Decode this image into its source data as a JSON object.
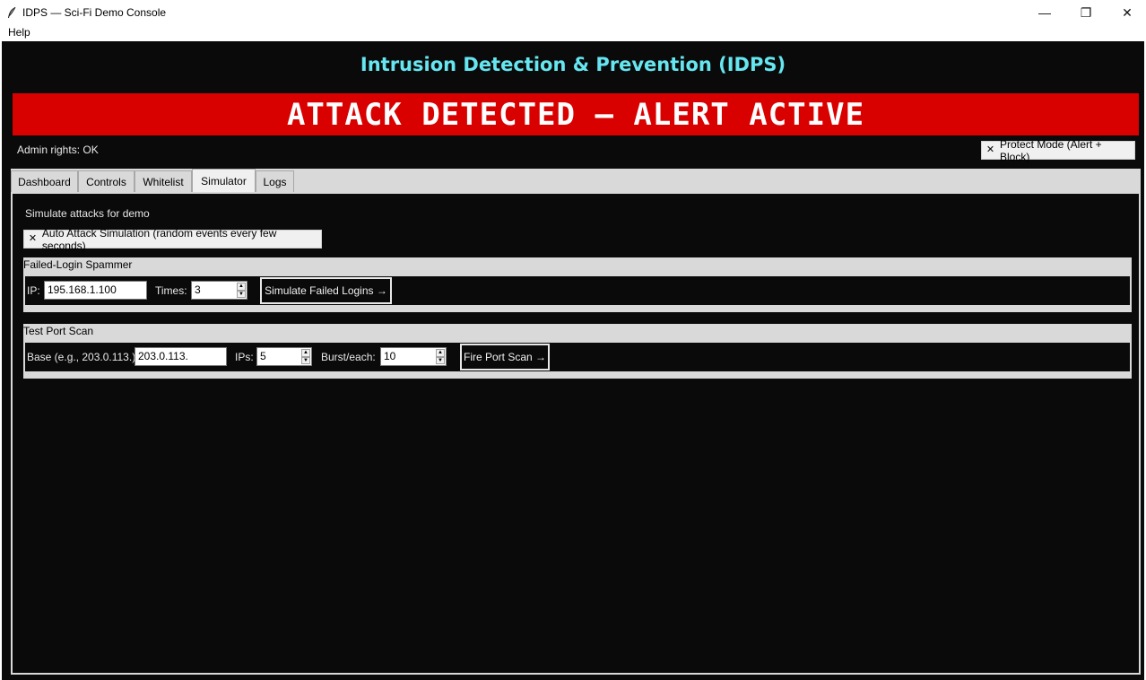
{
  "window": {
    "title": "IDPS — Sci-Fi Demo Console",
    "controls": {
      "minimize": "—",
      "maximize": "❐",
      "close": "✕"
    }
  },
  "menu": {
    "items": [
      "Help"
    ]
  },
  "header": {
    "title": "Intrusion Detection & Prevention (IDPS)",
    "alert": "ATTACK DETECTED — ALERT ACTIVE",
    "alert_color": "#d90000",
    "title_color": "#66e6f0"
  },
  "status": {
    "admin": "Admin rights: OK",
    "protect_mode": "Protect Mode (Alert + Block)",
    "protect_mode_checked": true
  },
  "tabs": [
    {
      "label": "Dashboard",
      "active": false
    },
    {
      "label": "Controls",
      "active": false
    },
    {
      "label": "Whitelist",
      "active": false
    },
    {
      "label": "Simulator",
      "active": true
    },
    {
      "label": "Logs",
      "active": false
    }
  ],
  "simulator": {
    "intro": "Simulate attacks for demo",
    "auto_sim": {
      "label": "Auto Attack Simulation (random events every few seconds)",
      "checked": true
    },
    "failed_login": {
      "title": "Failed-Login Spammer",
      "ip_label": "IP:",
      "ip_value": "195.168.1.100",
      "times_label": "Times:",
      "times_value": "3",
      "button": "Simulate Failed Logins →"
    },
    "port_scan": {
      "title": "Test Port Scan",
      "base_label": "Base (e.g., 203.0.113.):",
      "base_value": "203.0.113.",
      "ips_label": "IPs:",
      "ips_value": "5",
      "burst_label": "Burst/each:",
      "burst_value": "10",
      "button": "Fire Port Scan →"
    }
  },
  "icons": {
    "app": "feather-icon",
    "check": "✕",
    "spin_up": "▲",
    "spin_down": "▼"
  }
}
